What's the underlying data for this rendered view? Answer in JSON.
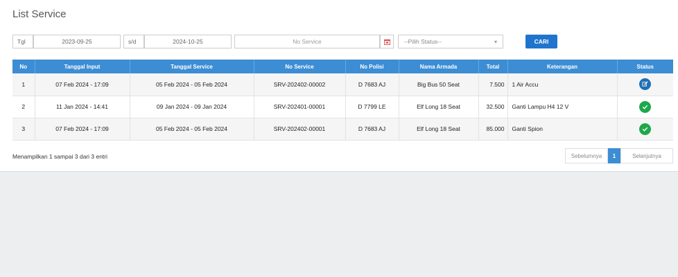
{
  "page": {
    "title": "List Service"
  },
  "filter": {
    "label_from": "Tgl",
    "date_from": "2023-09-25",
    "label_to": "s/d",
    "date_to": "2024-10-25",
    "service_placeholder": "No Service",
    "status_placeholder": "--Pilih Status--",
    "cari_label": "CARI"
  },
  "table": {
    "headers": [
      "No",
      "Tanggal Input",
      "Tanggal Service",
      "No Service",
      "No Polisi",
      "Nama Armada",
      "Total",
      "Keterangan",
      "Status"
    ],
    "rows": [
      {
        "no": "1",
        "tanggal_input": "07 Feb 2024 - 17:09",
        "tanggal_service": "05 Feb 2024 - 05 Feb 2024",
        "no_service": "SRV-202402-00002",
        "no_polisi": "D 7683 AJ",
        "armada": "Big Bus 50 Seat",
        "total": "7.500",
        "keterangan": "1 Air Accu",
        "status": "edit"
      },
      {
        "no": "2",
        "tanggal_input": "11 Jan 2024 - 14:41",
        "tanggal_service": "09 Jan 2024 - 09 Jan 2024",
        "no_service": "SRV-202401-00001",
        "no_polisi": "D 7799 LE",
        "armada": "Elf Long 18 Seat",
        "total": "32.500",
        "keterangan": "Ganti Lampu H4 12 V",
        "status": "done"
      },
      {
        "no": "3",
        "tanggal_input": "07 Feb 2024 - 17:09",
        "tanggal_service": "05 Feb 2024 - 05 Feb 2024",
        "no_service": "SRV-202402-00001",
        "no_polisi": "D 7683 AJ",
        "armada": "Elf Long 18 Seat",
        "total": "85.000",
        "keterangan": "Ganti Spion",
        "status": "done"
      }
    ]
  },
  "footer": {
    "info": "Menampilkan 1 sampai 3 dari 3 entri",
    "prev": "Sebelumnya",
    "page": "1",
    "next": "Selanjutnya"
  },
  "colors": {
    "header": "#3c8dd4",
    "edit": "#1f6fb5",
    "done": "#1fa84a",
    "cari": "#1f75cc"
  },
  "icons": {
    "calendar": "calendar-icon",
    "chevron": "chevron-down-icon",
    "edit": "edit-icon",
    "done": "check-circle-icon"
  }
}
